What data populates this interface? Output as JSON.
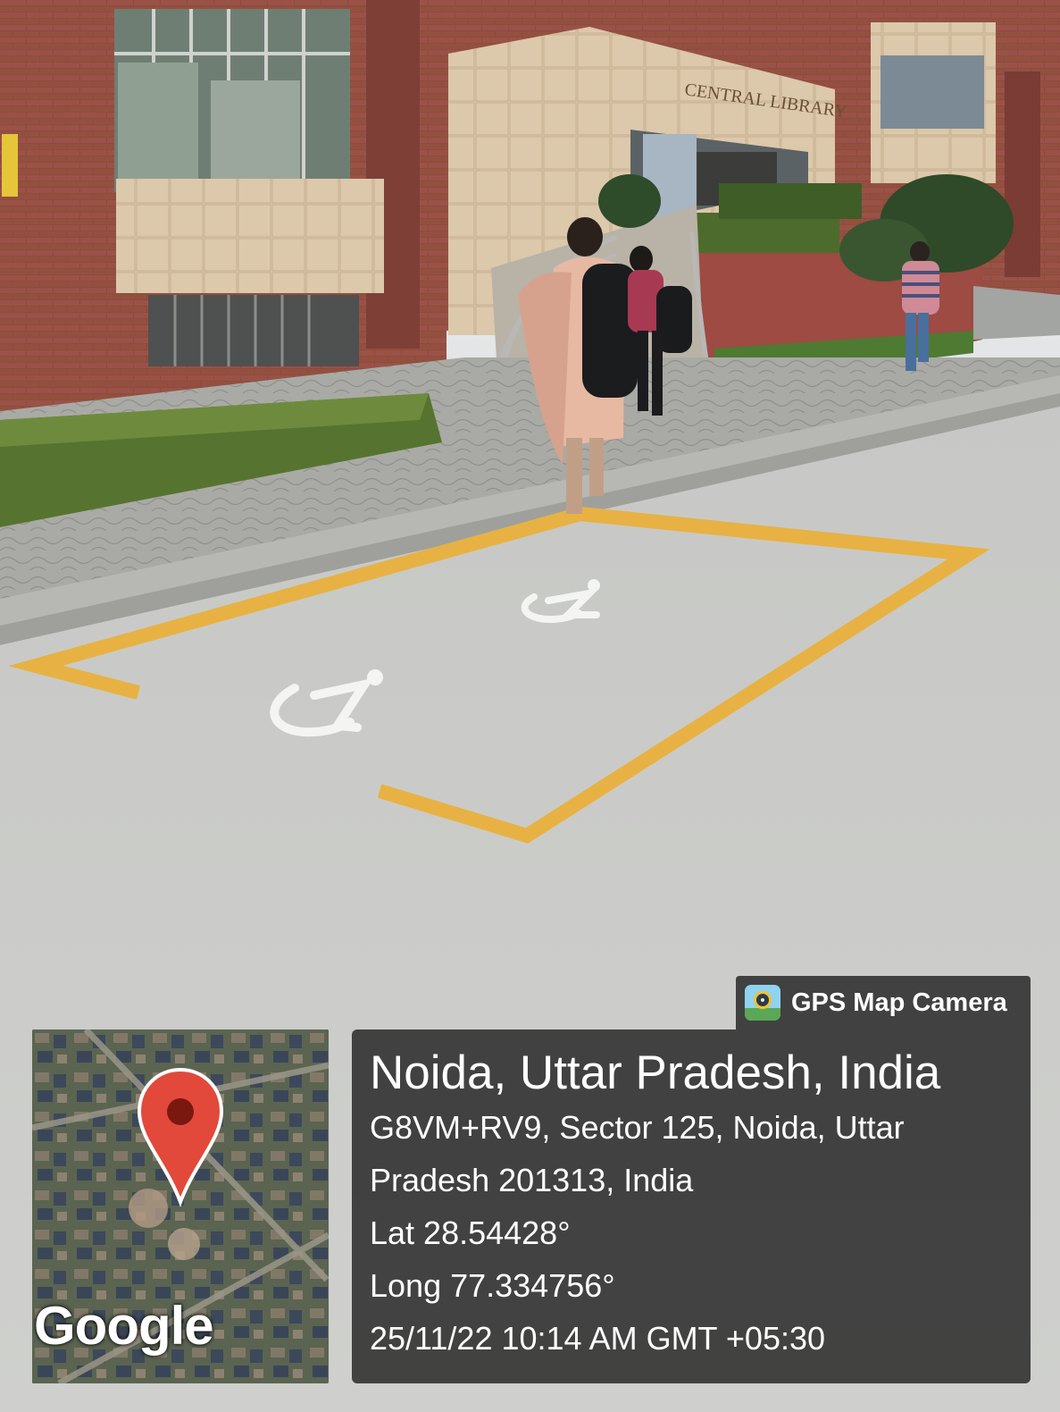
{
  "scene": {
    "building_sign": "CENTRAL LIBRARY"
  },
  "overlay": {
    "app_name": "GPS Map Camera",
    "app_icon": "gps-map-camera-app-icon",
    "map_attribution": "Google",
    "location_title": "Noida, Uttar Pradesh, India",
    "address_line_1": "G8VM+RV9, Sector 125, Noida, Uttar",
    "address_line_2": "Pradesh 201313, India",
    "latitude": "Lat 28.54428°",
    "longitude": "Long 77.334756°",
    "timestamp": "25/11/22 10:14 AM GMT +05:30"
  },
  "colors": {
    "parking_line": "#e7b243",
    "panel_bg": "#323232",
    "pin_red": "#e2493b"
  }
}
